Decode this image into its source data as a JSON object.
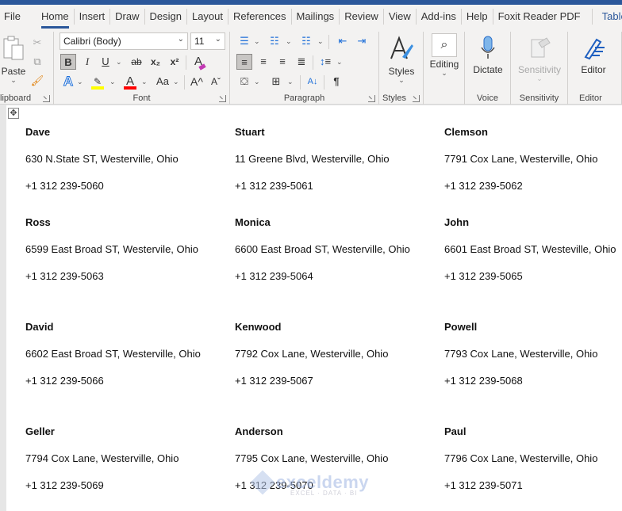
{
  "ribbon_tabs": [
    {
      "label": "File"
    },
    {
      "label": "Home",
      "active": true
    },
    {
      "label": "Insert"
    },
    {
      "label": "Draw"
    },
    {
      "label": "Design"
    },
    {
      "label": "Layout"
    },
    {
      "label": "References"
    },
    {
      "label": "Mailings"
    },
    {
      "label": "Review"
    },
    {
      "label": "View"
    },
    {
      "label": "Add-ins"
    },
    {
      "label": "Help"
    },
    {
      "label": "Foxit Reader PDF"
    },
    {
      "label": "Table De",
      "contextual": true
    }
  ],
  "clipboard": {
    "paste_label": "Paste",
    "group_label": "lipboard"
  },
  "font": {
    "font_name": "Calibri (Body)",
    "font_size": "11",
    "group_label": "Font",
    "buttons": {
      "bold": "B",
      "italic": "I",
      "underline": "U",
      "strikethrough": "ab",
      "subscript": "x₂",
      "superscript": "x²",
      "text_effects": "A",
      "highlight": "✎",
      "font_color": "A",
      "change_case": "Aa",
      "grow": "A^",
      "shrink": "Aˇ"
    },
    "highlight_color": "#ffff00",
    "font_color_value": "#ff0000"
  },
  "paragraph": {
    "group_label": "Paragraph",
    "pilcrow": "¶",
    "sort": "A↓"
  },
  "styles": {
    "label": "Styles",
    "group_label": "Styles"
  },
  "editing": {
    "label": "Editing"
  },
  "voice": {
    "label": "Dictate",
    "group_label": "Voice"
  },
  "sensitivity": {
    "label": "Sensitivity",
    "group_label": "Sensitivity"
  },
  "editor": {
    "label": "Editor",
    "group_label": "Editor"
  },
  "document": {
    "move_handle": "✥",
    "contacts": [
      {
        "name": "Dave",
        "address": "630 N.State ST, Westerville, Ohio",
        "phone": "+1 312 239-5060"
      },
      {
        "name": "Stuart",
        "address": "11 Greene Blvd, Westerville, Ohio",
        "phone": "+1 312 239-5061"
      },
      {
        "name": "Clemson",
        "address": "7791 Cox Lane, Westerville, Ohio",
        "phone": "+1 312 239-5062"
      },
      {
        "name": "Ross",
        "address": "6599 East Broad ST, Westervile, Ohio",
        "phone": "+1 312 239-5063"
      },
      {
        "name": "Monica",
        "address": "6600 East Broad ST, Westerville, Ohio",
        "phone": "+1 312 239-5064"
      },
      {
        "name": "John",
        "address": "6601 East Broad ST, Westeville, Ohio",
        "phone": "+1 312 239-5065"
      },
      {
        "name": "David",
        "address": "6602 East Broad ST, Westerville, Ohio",
        "phone": "+1 312 239-5066"
      },
      {
        "name": "Kenwood",
        "address": "7792 Cox Lane, Westerville, Ohio",
        "phone": "+1 312 239-5067"
      },
      {
        "name": "Powell",
        "address": "7793 Cox Lane, Westerville, Ohio",
        "phone": "+1 312 239-5068"
      },
      {
        "name": "Geller",
        "address": "7794 Cox Lane, Westerville, Ohio",
        "phone": "+1 312 239-5069"
      },
      {
        "name": "Anderson",
        "address": "7795 Cox Lane, Westerville, Ohio",
        "phone": "+1 312 239-5070"
      },
      {
        "name": "Paul",
        "address": "7796 Cox Lane, Westerville, Ohio",
        "phone": "+1 312 239-5071"
      }
    ]
  },
  "watermark": {
    "text": "exceldemy",
    "subtext": "EXCEL · DATA · BI"
  },
  "colors": {
    "accent": "#2b579a"
  }
}
